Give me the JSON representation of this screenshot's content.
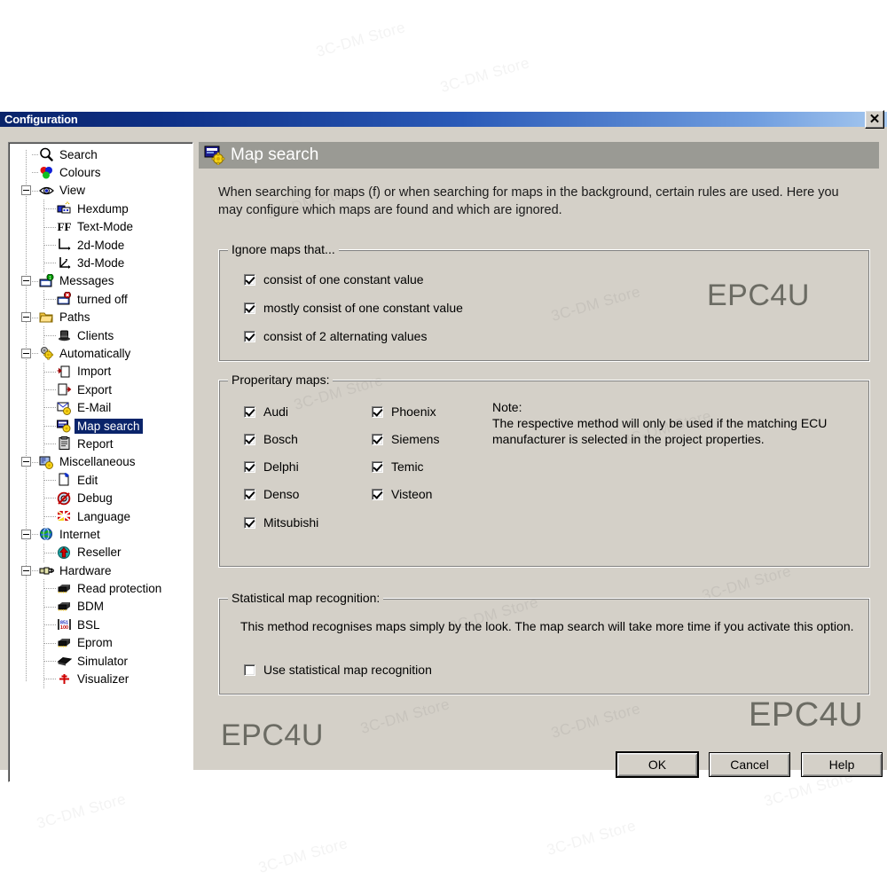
{
  "window": {
    "title": "Configuration",
    "close_label": "✕"
  },
  "sidebar": {
    "items": [
      {
        "label": "Search",
        "level": 0,
        "icon": "magnifier-icon",
        "expander": "none"
      },
      {
        "label": "Colours",
        "level": 0,
        "icon": "colour-circles-icon",
        "expander": "none"
      },
      {
        "label": "View",
        "level": 0,
        "icon": "eye-icon",
        "expander": "minus"
      },
      {
        "label": "Hexdump",
        "level": 1,
        "icon": "hexdump-icon",
        "expander": "none"
      },
      {
        "label": "Text-Mode",
        "level": 1,
        "icon": "ff-text-icon",
        "expander": "none"
      },
      {
        "label": "2d-Mode",
        "level": 1,
        "icon": "axes-2d-icon",
        "expander": "none"
      },
      {
        "label": "3d-Mode",
        "level": 1,
        "icon": "axes-3d-icon",
        "expander": "none"
      },
      {
        "label": "Messages",
        "level": 0,
        "icon": "messages-icon",
        "expander": "minus"
      },
      {
        "label": "turned off",
        "level": 1,
        "icon": "messages-off-icon",
        "expander": "none"
      },
      {
        "label": "Paths",
        "level": 0,
        "icon": "folder-icon",
        "expander": "minus"
      },
      {
        "label": "Clients",
        "level": 1,
        "icon": "client-hat-icon",
        "expander": "none"
      },
      {
        "label": "Automatically",
        "level": 0,
        "icon": "gears-icon",
        "expander": "minus"
      },
      {
        "label": "Import",
        "level": 1,
        "icon": "import-icon",
        "expander": "none"
      },
      {
        "label": "Export",
        "level": 1,
        "icon": "export-icon",
        "expander": "none"
      },
      {
        "label": "E-Mail",
        "level": 1,
        "icon": "email-gear-icon",
        "expander": "none"
      },
      {
        "label": "Map search",
        "level": 1,
        "icon": "map-search-icon",
        "expander": "none",
        "selected": true
      },
      {
        "label": "Report",
        "level": 1,
        "icon": "clipboard-icon",
        "expander": "none"
      },
      {
        "label": "Miscellaneous",
        "level": 0,
        "icon": "misc-gear-icon",
        "expander": "minus"
      },
      {
        "label": "Edit",
        "level": 1,
        "icon": "edit-page-icon",
        "expander": "none"
      },
      {
        "label": "Debug",
        "level": 1,
        "icon": "debug-bug-icon",
        "expander": "none"
      },
      {
        "label": "Language",
        "level": 1,
        "icon": "language-flag-icon",
        "expander": "none"
      },
      {
        "label": "Internet",
        "level": 0,
        "icon": "globe-icon",
        "expander": "minus"
      },
      {
        "label": "Reseller",
        "level": 1,
        "icon": "reseller-arrow-icon",
        "expander": "none"
      },
      {
        "label": "Hardware",
        "level": 0,
        "icon": "hardware-plug-icon",
        "expander": "minus"
      },
      {
        "label": "Read protection",
        "level": 1,
        "icon": "chip-icon",
        "expander": "none"
      },
      {
        "label": "BDM",
        "level": 1,
        "icon": "chip-icon",
        "expander": "none"
      },
      {
        "label": "BSL",
        "level": 1,
        "icon": "bsl-icon",
        "expander": "none"
      },
      {
        "label": "Eprom",
        "level": 1,
        "icon": "chip-icon",
        "expander": "none"
      },
      {
        "label": "Simulator",
        "level": 1,
        "icon": "simulator-icon",
        "expander": "none"
      },
      {
        "label": "Visualizer",
        "level": 1,
        "icon": "visualizer-icon",
        "expander": "none"
      }
    ]
  },
  "page": {
    "header_title": "Map search",
    "header_icon": "map-search-icon",
    "description": "When searching for maps (f) or when searching for maps in the background, certain rules are used. Here you may configure which maps are found and which are ignored."
  },
  "ignore_group": {
    "title": "Ignore maps that...",
    "options": [
      {
        "label": "consist of one constant value",
        "checked": true
      },
      {
        "label": "mostly consist of one constant value",
        "checked": true
      },
      {
        "label": "consist of 2 alternating values",
        "checked": true
      }
    ]
  },
  "proprietary_group": {
    "title": "Properitary maps:",
    "column1": [
      {
        "label": "Audi",
        "checked": true
      },
      {
        "label": "Bosch",
        "checked": true
      },
      {
        "label": "Delphi",
        "checked": true
      },
      {
        "label": "Denso",
        "checked": true
      },
      {
        "label": "Mitsubishi",
        "checked": true
      }
    ],
    "column2": [
      {
        "label": "Phoenix",
        "checked": true
      },
      {
        "label": "Siemens",
        "checked": true
      },
      {
        "label": "Temic",
        "checked": true
      },
      {
        "label": "Visteon",
        "checked": true
      }
    ],
    "note": "Note:\nThe respective method will only be used if the matching ECU\nmanufacturer is selected in the project properties."
  },
  "statistical_group": {
    "title": "Statistical map recognition:",
    "description": "This method recognises maps simply by the look. The map search will take more time if you activate this option.",
    "option": {
      "label": "Use statistical map recognition",
      "checked": false
    }
  },
  "buttons": {
    "ok": "OK",
    "cancel": "Cancel",
    "help": "Help"
  },
  "watermarks": {
    "store": "3C-DM Store",
    "brand": "EPC4U"
  },
  "colors": {
    "titlebar_start": "#0a246a",
    "titlebar_end": "#a6c8ef",
    "dialog_face": "#d4d0c8",
    "page_header": "#9a9a94",
    "selection": "#0a246a"
  }
}
